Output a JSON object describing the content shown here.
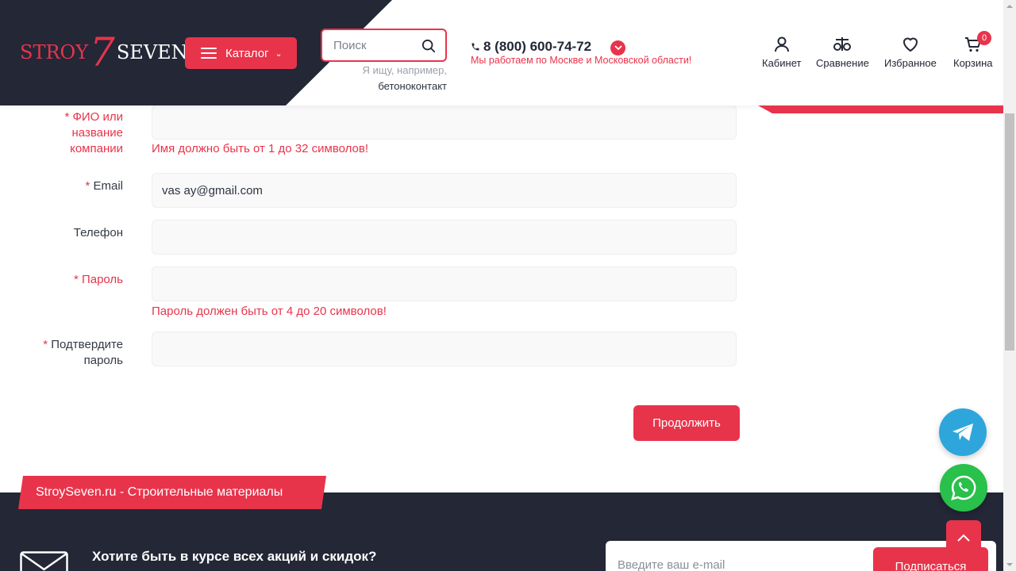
{
  "header": {
    "logo": {
      "left": "STROY",
      "number": "7",
      "right": "SEVEN"
    },
    "catalog_label": "Каталог",
    "search": {
      "placeholder": "Поиск",
      "hint_prefix": "Я ищу, например,",
      "hint_example": "бетоноконтакт"
    },
    "phone": "8 (800) 600-74-72",
    "region": "Мы работаем по Москве и Московской области!",
    "nav": {
      "cabinet": "Кабинет",
      "compare": "Сравнение",
      "favorites": "Избранное",
      "cart": "Корзина",
      "cart_count": "0"
    }
  },
  "form": {
    "required_mark": "*",
    "name": {
      "label_line1": "ФИО или",
      "label_line2": "название",
      "label_line3": "компании",
      "value": "",
      "error": "Имя должно быть от 1 до 32 символов!"
    },
    "email": {
      "label": "Email",
      "value": "vas ay@gmail.com"
    },
    "phone": {
      "label": "Телефон",
      "value": ""
    },
    "password": {
      "label": "Пароль",
      "value": "",
      "error": "Пароль должен быть от 4 до 20 символов!"
    },
    "confirm": {
      "label_line1": "Подтвердите",
      "label_line2": "пароль",
      "value": ""
    },
    "continue_label": "Продолжить"
  },
  "footer": {
    "tag": "StroySeven.ru - Строительные материалы",
    "newsletter_title": "Хотите быть в курсе всех акций и скидок?",
    "newsletter_placeholder": "Введите ваш e-mail",
    "subscribe_label": "Подписаться"
  },
  "colors": {
    "accent": "#e8344b",
    "dark": "#232736",
    "telegram": "#2ea6dc",
    "whatsapp": "#29c04b"
  }
}
